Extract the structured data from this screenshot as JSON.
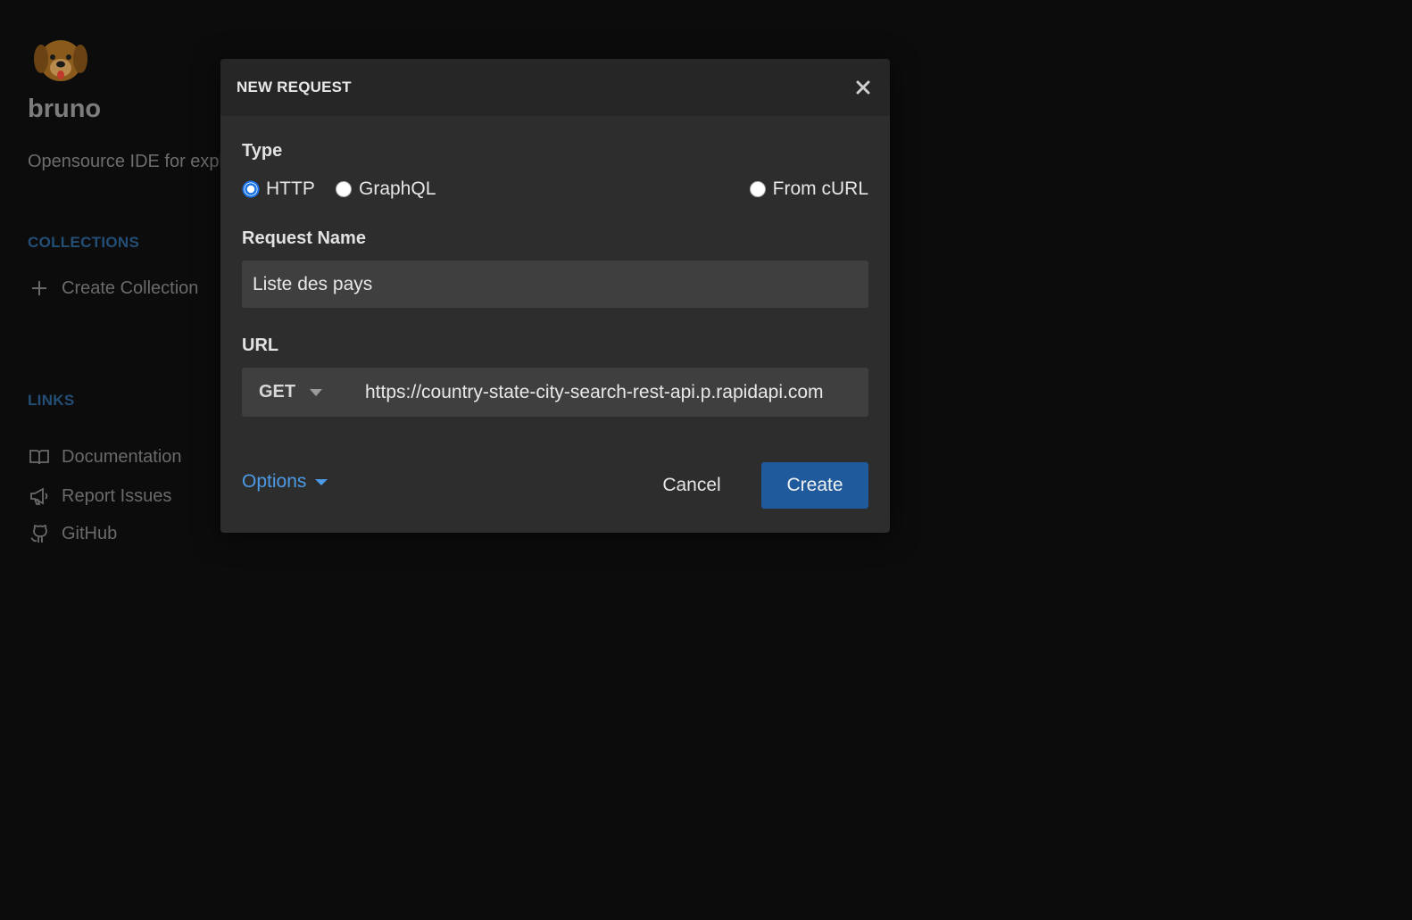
{
  "home": {
    "brand": "bruno",
    "tagline": "Opensource IDE for exploring and testing APIs",
    "collections_title": "COLLECTIONS",
    "create_collection": "Create Collection",
    "links_title": "LINKS",
    "links": [
      {
        "label": "Documentation",
        "icon": "book-icon"
      },
      {
        "label": "Report Issues",
        "icon": "megaphone-icon"
      },
      {
        "label": "GitHub",
        "icon": "github-icon"
      }
    ]
  },
  "modal": {
    "title": "NEW REQUEST",
    "type_label": "Type",
    "types": [
      {
        "label": "HTTP",
        "checked": true
      },
      {
        "label": "GraphQL",
        "checked": false
      },
      {
        "label": "From cURL",
        "checked": false
      }
    ],
    "name_label": "Request Name",
    "name_value": "Liste des pays",
    "url_label": "URL",
    "method": "GET",
    "url_value": "https://country-state-city-search-rest-api.p.rapidapi.com",
    "options_label": "Options",
    "cancel_label": "Cancel",
    "create_label": "Create"
  },
  "colors": {
    "accent": "#1f5b9c",
    "link": "#4d9ae6",
    "background": "#0c0c0c",
    "modal": "#2d2d2d"
  }
}
